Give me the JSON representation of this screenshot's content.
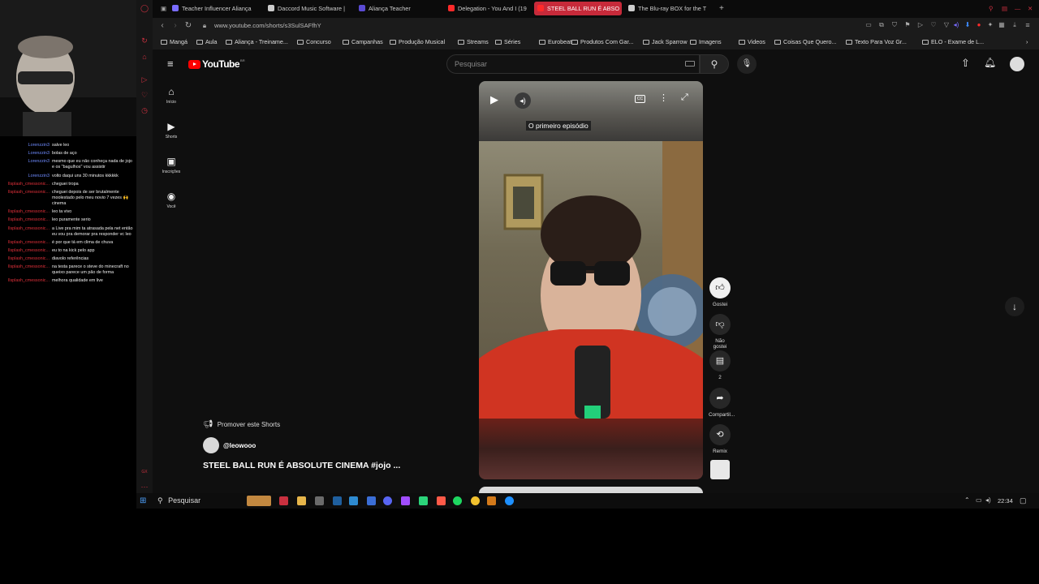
{
  "browser": {
    "tabs": [
      {
        "label": "Teacher Influencer Aliança",
        "color": "#7a6cff",
        "active": false
      },
      {
        "label": "Daccord Music Software |",
        "color": "#cccccc",
        "active": false
      },
      {
        "label": "Aliança Teacher",
        "color": "#5b4bd4",
        "active": false
      },
      {
        "label": "Delegation - You And I (19",
        "color": "#ff2a2a",
        "active": false
      },
      {
        "label": "STEEL BALL RUN É ABSO",
        "color": "#ff2a2a",
        "active": true
      },
      {
        "label": "The Blu-ray BOX for the T",
        "color": "#cccccc",
        "active": false
      }
    ],
    "new_tab": "+",
    "url": "www.youtube.com/shorts/s3SulSAFfhY",
    "bookmarks": [
      "Mangá",
      "Aula",
      "Aliança - Treiname...",
      "Concurso",
      "Campanhas",
      "Produção Musical",
      "Streams",
      "Séries",
      "Eurobeat",
      "Produtos Com Gar...",
      "Jack Sparrow",
      "Imagens",
      "Videos",
      "Coisas Que Quero...",
      "Texto Para Voz Gr...",
      "ELO - Exame de L..."
    ]
  },
  "youtube": {
    "logo": "YouTube",
    "logo_tag": "BR",
    "search_placeholder": "Pesquisar",
    "nav": [
      "Início",
      "Shorts",
      "Inscrições",
      "Você"
    ],
    "player": {
      "caption": "O primeiro episódio",
      "icons": [
        "play-icon",
        "volume-icon",
        "captions-icon",
        "more-icon",
        "fullscreen-icon"
      ]
    },
    "actions": {
      "like": "Gostei",
      "dislike": "Não gostei",
      "comments_count": "2",
      "share": "Compartil...",
      "remix": "Remix"
    },
    "promote": "Promover este Shorts",
    "channel": "@leowooo",
    "title": "STEEL BALL RUN É ABSOLUTE CINEMA #jojo ..."
  },
  "chat": [
    {
      "user": "Lorenzzin3",
      "msg": "salve leo",
      "color": "#6f8bff"
    },
    {
      "user": "Lorenzzin3",
      "msg": "bolas de aço",
      "color": "#6f8bff"
    },
    {
      "user": "Lorenzzin3",
      "msg": "mesmo que eu não conheça nada de jojo e os \"bagulhos\" vou assistir",
      "color": "#6f8bff"
    },
    {
      "user": "Lorenzzin3",
      "msg": "volto daqui uns 30 minutos kkkkkk",
      "color": "#6f8bff"
    },
    {
      "user": "Ilsplash_cmessonic...",
      "msg": "cheguei tropa",
      "color": "#e2303a"
    },
    {
      "user": "Ilsplash_cmessonic...",
      "msg": "cheguei depois de ser brutalmente moolestado pelo meu novio 7 vezes 🙌 cinema",
      "color": "#e2303a"
    },
    {
      "user": "Ilsplash_cmessonic...",
      "msg": "leo ta vivo",
      "color": "#e2303a"
    },
    {
      "user": "Ilsplash_cmessonic...",
      "msg": "leo puramente serio",
      "color": "#e2303a"
    },
    {
      "user": "Ilsplash_cmessonic...",
      "msg": "a Live pra mim ta atrasada pela net então eu vou pra demorar pra responder vc leo",
      "color": "#e2303a"
    },
    {
      "user": "Ilsplash_cmessonic...",
      "msg": "é por que tá em clima de chuva",
      "color": "#e2303a"
    },
    {
      "user": "Ilsplash_cmessonic...",
      "msg": "eu to na kick pelo app",
      "color": "#e2303a"
    },
    {
      "user": "Ilsplash_cmessonic...",
      "msg": "diavolo referências",
      "color": "#e2303a"
    },
    {
      "user": "Ilsplash_cmessonic...",
      "msg": "na testa parece o steve do minecraft no queixo parece um pão de forma",
      "color": "#e2303a"
    },
    {
      "user": "Ilsplash_cmessonic...",
      "msg": "melhora qualidade em live",
      "color": "#e2303a"
    }
  ],
  "taskbar": {
    "search": "Pesquisar",
    "time": "22:34"
  }
}
